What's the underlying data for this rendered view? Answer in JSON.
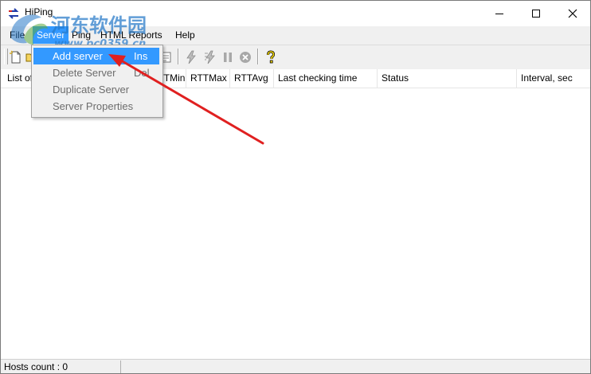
{
  "window": {
    "title": "HiPing",
    "min_icon": "minimize-icon",
    "max_icon": "maximize-icon",
    "close_icon": "close-icon"
  },
  "watermark": {
    "text": "河东软件园",
    "url": "www.pc0359.cn",
    "color": "#2678c8"
  },
  "menubar": {
    "items": [
      {
        "label": "File"
      },
      {
        "label": "Server"
      },
      {
        "label": "Ping"
      },
      {
        "label": "HTML Reports"
      },
      {
        "label": "Help"
      }
    ],
    "active_color": "#3399ff"
  },
  "server_menu": {
    "items": [
      {
        "label": "Add server",
        "shortcut": "Ins",
        "enabled": true,
        "highlighted": true
      },
      {
        "label": "Delete Server",
        "shortcut": "Del",
        "enabled": false
      },
      {
        "label": "Duplicate Server",
        "shortcut": "",
        "enabled": false
      },
      {
        "label": "Server Properties",
        "shortcut": "",
        "enabled": false
      }
    ]
  },
  "toolbar": {
    "icons": [
      "new-icon",
      "open-icon",
      "properties-icon",
      "ping-icon",
      "ping-all-icon",
      "pause-icon",
      "stop-icon",
      "help-icon"
    ]
  },
  "grid": {
    "columns": [
      "List of",
      "RTTMin",
      "RTTMax",
      "RTTAvg",
      "Last checking time",
      "Status",
      "Interval, sec"
    ]
  },
  "statusbar": {
    "hosts_count": "Hosts count : 0"
  },
  "annotation": {
    "arrow_color": "#e02020"
  }
}
